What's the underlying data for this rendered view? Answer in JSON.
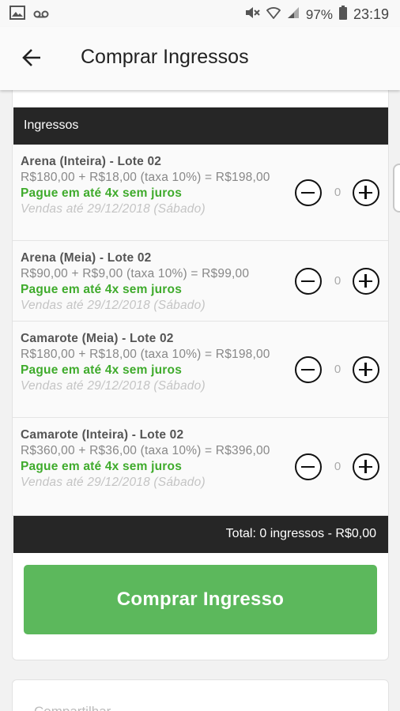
{
  "status_bar": {
    "left_icons": [
      "image-icon",
      "voicemail-icon"
    ],
    "right_icons": [
      "mute-icon",
      "wifi-icon",
      "signal-icon",
      "battery-icon"
    ],
    "battery": "97%",
    "time": "23:19"
  },
  "app_bar": {
    "back_icon": "arrow-left-icon",
    "title": "Comprar Ingressos"
  },
  "tickets_section": {
    "header": "Ingressos",
    "items": [
      {
        "name": "Arena (Inteira) - Lote 02",
        "price": "R$180,00 + R$18,00 (taxa 10%) = R$198,00",
        "promo": "Pague em até 4x sem juros",
        "until": "Vendas até 29/12/2018 (Sábado)",
        "quantity": "0"
      },
      {
        "name": "Arena (Meia) - Lote 02",
        "price": "R$90,00 + R$9,00 (taxa 10%) = R$99,00",
        "promo": "Pague em até 4x sem juros",
        "until": "Vendas até 29/12/2018 (Sábado)",
        "quantity": "0"
      },
      {
        "name": "Camarote (Meia) - Lote 02",
        "price": "R$180,00 + R$18,00 (taxa 10%) = R$198,00",
        "promo": "Pague em até 4x sem juros",
        "until": "Vendas até 29/12/2018 (Sábado)",
        "quantity": "0"
      },
      {
        "name": "Camarote (Inteira) - Lote 02",
        "price": "R$360,00 + R$36,00 (taxa 10%) = R$396,00",
        "promo": "Pague em até 4x sem juros",
        "until": "Vendas até 29/12/2018 (Sábado)",
        "quantity": "0"
      }
    ],
    "total": "Total: 0 ingressos - R$0,00"
  },
  "buy_button": "Comprar Ingresso",
  "share_section": {
    "label": "Compartilhar"
  },
  "colors": {
    "accent_green": "#5cb85c",
    "promo_green": "#3fab2c",
    "dark_bar": "#262626"
  }
}
